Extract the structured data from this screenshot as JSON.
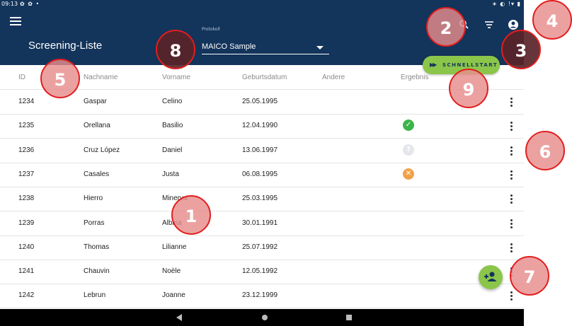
{
  "status_bar": {
    "time": "09:13",
    "left_icons": "✿ ✿ •",
    "right_icons": "∗ ◐ !▾ ▮"
  },
  "app_bar": {
    "title": "Screening-Liste",
    "protokoll_label": "Protokoll",
    "protokoll_value": "MAICO Sample",
    "schnellstart_label": "SCHNELLSTART"
  },
  "table": {
    "headers": [
      "ID",
      "Nachname",
      "Vorname",
      "Geburtsdatum",
      "Andere",
      "Ergebnis"
    ],
    "rows": [
      {
        "id": "1234",
        "nachname": "Gaspar",
        "vorname": "Celino",
        "geburtsdatum": "25.05.1995",
        "andere": "",
        "ergebnis": ""
      },
      {
        "id": "1235",
        "nachname": "Orellana",
        "vorname": "Basilio",
        "geburtsdatum": "12.04.1990",
        "andere": "",
        "ergebnis": "pass"
      },
      {
        "id": "1236",
        "nachname": "Cruz López",
        "vorname": "Daniel",
        "geburtsdatum": "13.06.1997",
        "andere": "",
        "ergebnis": "unknown"
      },
      {
        "id": "1237",
        "nachname": "Casales",
        "vorname": "Justa",
        "geburtsdatum": "06.08.1995",
        "andere": "",
        "ergebnis": "fail"
      },
      {
        "id": "1238",
        "nachname": "Hierro",
        "vorname": "Minerva",
        "geburtsdatum": "25.03.1995",
        "andere": "",
        "ergebnis": ""
      },
      {
        "id": "1239",
        "nachname": "Porras",
        "vorname": "Albina",
        "geburtsdatum": "30.01.1991",
        "andere": "",
        "ergebnis": ""
      },
      {
        "id": "1240",
        "nachname": "Thomas",
        "vorname": "Lilianne",
        "geburtsdatum": "25.07.1992",
        "andere": "",
        "ergebnis": ""
      },
      {
        "id": "1241",
        "nachname": "Chauvin",
        "vorname": "Noèle",
        "geburtsdatum": "12.05.1992",
        "andere": "",
        "ergebnis": ""
      },
      {
        "id": "1242",
        "nachname": "Lebrun",
        "vorname": "Joanne",
        "geburtsdatum": "23.12.1999",
        "andere": "",
        "ergebnis": ""
      }
    ]
  },
  "callouts": [
    "1",
    "2",
    "3",
    "4",
    "5",
    "6",
    "7",
    "8",
    "9"
  ],
  "colors": {
    "app_bar": "#13345b",
    "accent_green": "#8bc54a",
    "pass": "#3bb54a",
    "fail": "#f0a24a",
    "callout_border": "#e21e1e"
  },
  "icons": [
    "menu-icon",
    "search-icon",
    "filter-icon",
    "account-icon",
    "play-icon",
    "check-icon",
    "question-icon",
    "close-icon",
    "more-vert-icon",
    "add-person-icon"
  ]
}
